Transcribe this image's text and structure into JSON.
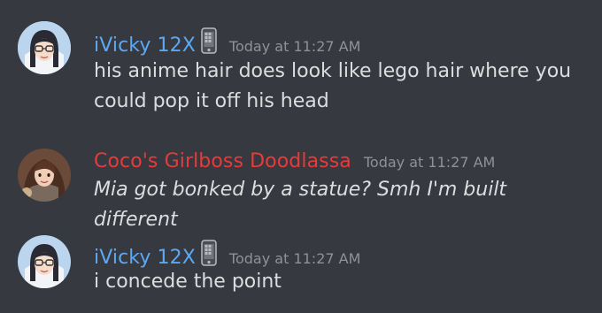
{
  "messages": [
    {
      "username": "iVicky 12X",
      "username_color": "#5da8f2",
      "badge_icon": "mobile-phone-icon",
      "timestamp": "Today at 11:27 AM",
      "text": "his anime hair does look like lego hair where you could pop it off his head",
      "italic": false
    },
    {
      "username": "Coco's Girlboss Doodlassa",
      "username_color": "#e83a3a",
      "timestamp": "Today at 11:27 AM",
      "text": "Mia got bonked by a statue? Smh I'm built different",
      "italic": true
    },
    {
      "username": "iVicky 12X",
      "username_color": "#5da8f2",
      "badge_icon": "mobile-phone-icon",
      "timestamp": "Today at 11:27 AM",
      "text": "i concede the point",
      "italic": false
    }
  ],
  "colors": {
    "background": "#36393f",
    "text": "#dcddde",
    "timestamp": "#8e9297"
  }
}
